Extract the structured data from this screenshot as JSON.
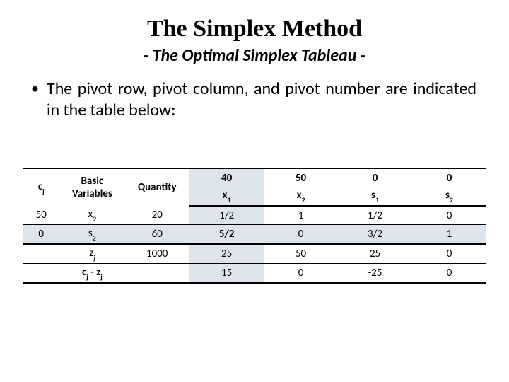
{
  "title": "The Simplex Method",
  "subtitle": "- The Optimal Simplex Tableau -",
  "bullet_text": "The pivot row, pivot column, and pivot number are indicated in the table below:",
  "tableau": {
    "header": {
      "cj_label_c": "c",
      "cj_label_j": "j",
      "basic_variables": "Basic Variables",
      "quantity": "Quantity",
      "cost_row": [
        "40",
        "50",
        "0",
        "0"
      ],
      "var_labels": [
        {
          "main": "x",
          "sub": "1"
        },
        {
          "main": "x",
          "sub": "2"
        },
        {
          "main": "s",
          "sub": "1"
        },
        {
          "main": "s",
          "sub": "2"
        }
      ]
    },
    "rows": [
      {
        "cj": "50",
        "basic": {
          "main": "x",
          "sub": "2"
        },
        "qty": "20",
        "vals": [
          "1/2",
          "1",
          "1/2",
          "0"
        ]
      },
      {
        "cj": "0",
        "basic": {
          "main": "s",
          "sub": "2"
        },
        "qty": "60",
        "vals": [
          "5/2",
          "0",
          "3/2",
          "1"
        ]
      }
    ],
    "footer": {
      "zj": {
        "main": "z",
        "sub": "j"
      },
      "zj_qty": "1000",
      "zj_vals": [
        "25",
        "50",
        "25",
        "0"
      ],
      "diff_c": "c",
      "diff_j": "j",
      "diff_dash": " - ",
      "diff_z": "z",
      "diff_j2": "j",
      "diff_vals": [
        "15",
        "0",
        "-25",
        "0"
      ]
    }
  }
}
